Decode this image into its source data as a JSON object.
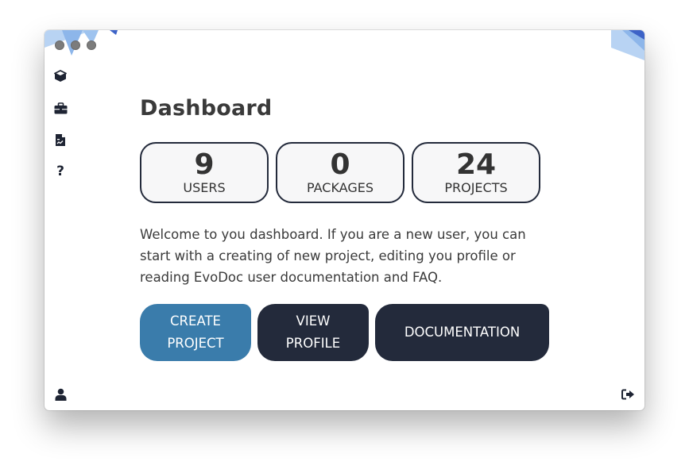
{
  "window": {
    "traffic_lights": [
      "close",
      "minimize",
      "maximize"
    ]
  },
  "sidebar": {
    "items": [
      {
        "name": "packages",
        "icon": "cube-icon"
      },
      {
        "name": "projects",
        "icon": "briefcase-icon"
      },
      {
        "name": "documents",
        "icon": "document-icon"
      },
      {
        "name": "help",
        "icon": "question-icon",
        "glyph": "?"
      }
    ],
    "bottom": {
      "profile_icon": "user-icon"
    }
  },
  "logout": {
    "icon": "sign-out-icon"
  },
  "dashboard": {
    "title": "Dashboard",
    "stats": [
      {
        "value": "9",
        "label": "USERS"
      },
      {
        "value": "0",
        "label": "PACKAGES"
      },
      {
        "value": "24",
        "label": "PROJECTS"
      }
    ],
    "welcome_text": "Welcome to you dashboard. If you are a new user, you can start with a creating of new project, editing you profile or reading EvoDoc user documentation and FAQ.",
    "buttons": {
      "create_project": "CREATE PROJECT",
      "view_profile": "VIEW PROFILE",
      "documentation": "DOCUMENTATION"
    }
  },
  "colors": {
    "primary": "#3a7cab",
    "dark": "#232a3b",
    "decoration_light": "#9ec3ef",
    "decoration_dark": "#3d63c7"
  }
}
